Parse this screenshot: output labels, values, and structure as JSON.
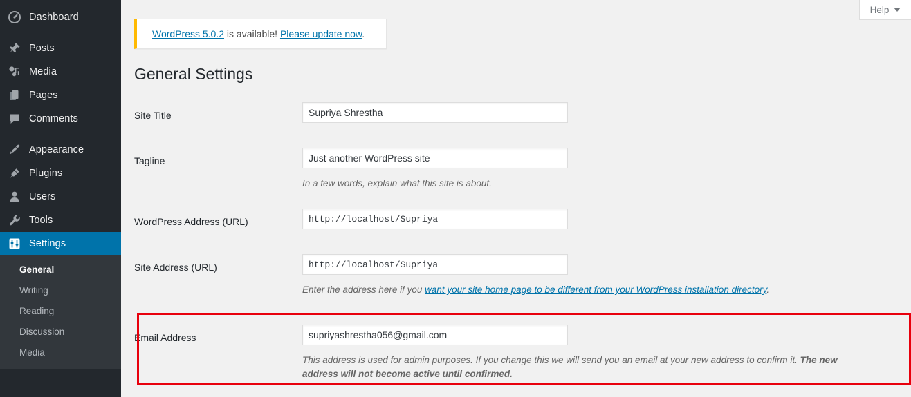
{
  "sidebar": {
    "items": [
      {
        "label": "Dashboard",
        "icon": "dashboard-gauge-icon"
      },
      {
        "label": "Posts",
        "icon": "pushpin-icon"
      },
      {
        "label": "Media",
        "icon": "media-note-icon"
      },
      {
        "label": "Pages",
        "icon": "pages-stack-icon"
      },
      {
        "label": "Comments",
        "icon": "comment-bubble-icon"
      },
      {
        "label": "Appearance",
        "icon": "paintbrush-icon"
      },
      {
        "label": "Plugins",
        "icon": "plug-icon"
      },
      {
        "label": "Users",
        "icon": "user-icon"
      },
      {
        "label": "Tools",
        "icon": "wrench-icon"
      },
      {
        "label": "Settings",
        "icon": "settings-sliders-icon"
      }
    ],
    "submenu": [
      {
        "label": "General",
        "current": true
      },
      {
        "label": "Writing",
        "current": false
      },
      {
        "label": "Reading",
        "current": false
      },
      {
        "label": "Discussion",
        "current": false
      },
      {
        "label": "Media",
        "current": false
      }
    ]
  },
  "help_tab": {
    "label": "Help"
  },
  "notice": {
    "link_version": "WordPress 5.0.2",
    "middle_text": " is available! ",
    "link_update": "Please update now",
    "trailing_text": "."
  },
  "page": {
    "title": "General Settings"
  },
  "form": {
    "site_title": {
      "label": "Site Title",
      "value": "Supriya Shrestha"
    },
    "tagline": {
      "label": "Tagline",
      "value": "Just another WordPress site",
      "description": "In a few words, explain what this site is about."
    },
    "wordpress_address": {
      "label": "WordPress Address (URL)",
      "value": "http://localhost/Supriya"
    },
    "site_address": {
      "label": "Site Address (URL)",
      "value": "http://localhost/Supriya",
      "desc_prefix": "Enter the address here if you ",
      "desc_link": "want your site home page to be different from your WordPress installation directory",
      "desc_suffix": "."
    },
    "email_address": {
      "label": "Email Address",
      "value": "supriyashrestha056@gmail.com",
      "desc_normal": "This address is used for admin purposes. If you change this we will send you an email at your new address to confirm it. ",
      "desc_bold": "The new address will not become active until confirmed."
    }
  },
  "colors": {
    "sidebar_bg": "#23282d",
    "submenu_bg": "#32373c",
    "accent_blue": "#0073aa",
    "notice_amber": "#ffb900",
    "annotation_red": "#e8000d",
    "content_bg": "#f1f1f1"
  }
}
